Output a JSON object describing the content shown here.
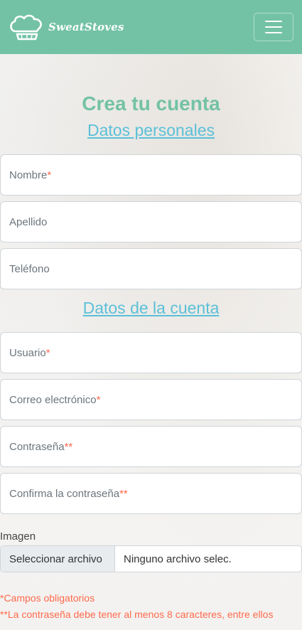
{
  "navbar": {
    "brand": "SweatStoves",
    "brand_icon": "chef-hat-icon",
    "menu_icon": "hamburger-menu-icon",
    "color": "#73c2a6"
  },
  "page": {
    "title": "Crea tu cuenta",
    "section_personal": "Datos personales",
    "section_account": "Datos de la cuenta"
  },
  "fields": {
    "nombre": {
      "label": "Nombre",
      "mark": "*"
    },
    "apellido": {
      "label": "Apellido"
    },
    "telefono": {
      "label": "Teléfono"
    },
    "usuario": {
      "label": "Usuario",
      "mark": "*"
    },
    "correo": {
      "label": "Correo electrónico",
      "mark": "*"
    },
    "contrasena": {
      "label": "Contraseña",
      "mark": "**"
    },
    "confirma": {
      "label": "Confirma la contraseña",
      "mark": "**"
    }
  },
  "file": {
    "label": "Imagen",
    "button": "Seleccionar archivo",
    "value": "Ninguno archivo selec."
  },
  "notes": {
    "required": "*Campos obligatorios",
    "password": "**La contraseña debe tener al menos 8 caracteres, entre ellos"
  },
  "colors": {
    "accent": "#73c2a6",
    "link": "#5bc0d8",
    "required": "#ff6a4d"
  }
}
